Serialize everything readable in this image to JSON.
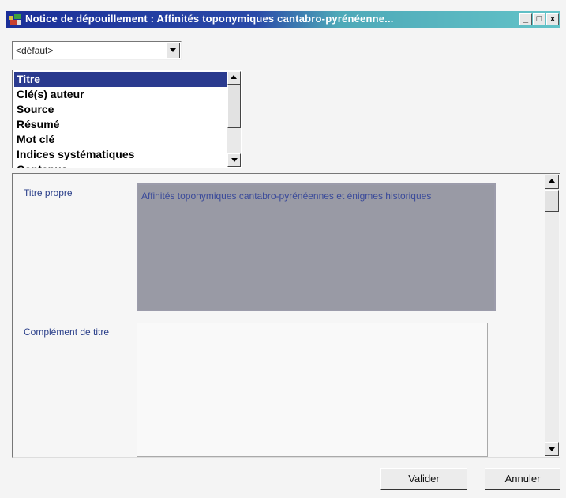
{
  "window": {
    "title": "Notice de dépouillement : Affinités toponymiques cantabro-pyrénéenne...",
    "controls": {
      "minimize": "_",
      "maximize": "□",
      "close": "x"
    }
  },
  "view_select": {
    "value": "<défaut>"
  },
  "sections_list": {
    "items": [
      {
        "label": "Titre",
        "selected": true
      },
      {
        "label": "Clé(s) auteur"
      },
      {
        "label": "Source"
      },
      {
        "label": "Résumé"
      },
      {
        "label": "Mot clé"
      },
      {
        "label": "Indices systématiques"
      },
      {
        "label": "Contenus"
      }
    ]
  },
  "form": {
    "titre_propre": {
      "label": "Titre propre",
      "value": "Affinités toponymiques cantabro-pyrénéennes et énigmes historiques"
    },
    "complement_titre": {
      "label": "Complément de titre",
      "value": ""
    }
  },
  "buttons": {
    "validate": "Valider",
    "cancel": "Annuler"
  },
  "colors": {
    "titlebar_start": "#1b2f98",
    "titlebar_end": "#63c3c8",
    "selection": "#2b3b8f",
    "filled_field": "#999aa5"
  }
}
